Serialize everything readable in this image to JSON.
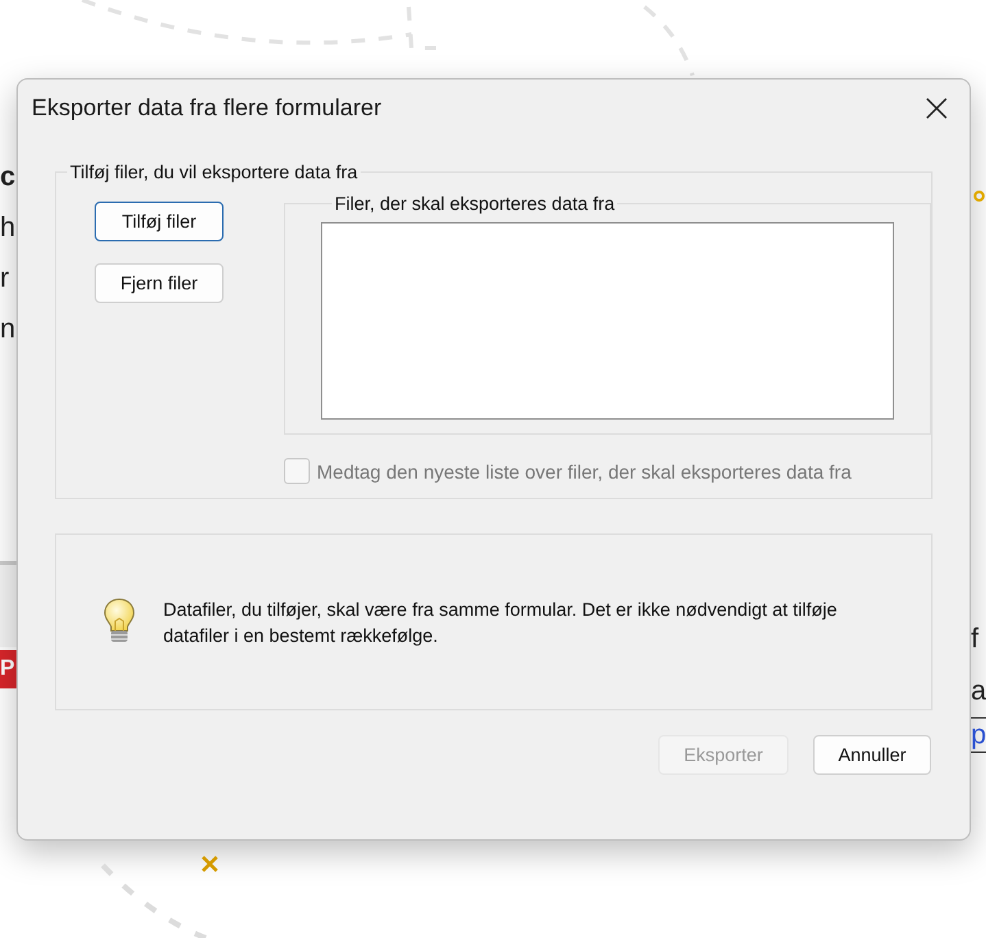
{
  "window": {
    "title": "Eksporter data fra flere formularer"
  },
  "background": {
    "left_fragments": [
      "c",
      "h",
      "r",
      "n"
    ],
    "left_badge": "P",
    "right_fragments": [
      "f",
      "a"
    ],
    "right_link": "p"
  },
  "add_group": {
    "legend": "Tilføj filer, du vil eksportere data fra",
    "buttons": [
      {
        "label": "Tilføj filer",
        "focused": true
      },
      {
        "label": "Fjern filer",
        "focused": false
      }
    ],
    "files_group": {
      "legend": "Filer, der skal eksporteres data fra"
    },
    "include_latest": {
      "label": "Medtag den nyeste liste over filer, der skal eksporteres data fra",
      "checked": false,
      "disabled": true
    }
  },
  "info": {
    "text": "Datafiler, du tilføjer, skal være fra samme formular. Det er ikke nødvendigt at tilføje datafiler i en bestemt rækkefølge."
  },
  "buttons": [
    {
      "label": "Eksporter",
      "disabled": true
    },
    {
      "label": "Annuller",
      "disabled": false
    }
  ]
}
